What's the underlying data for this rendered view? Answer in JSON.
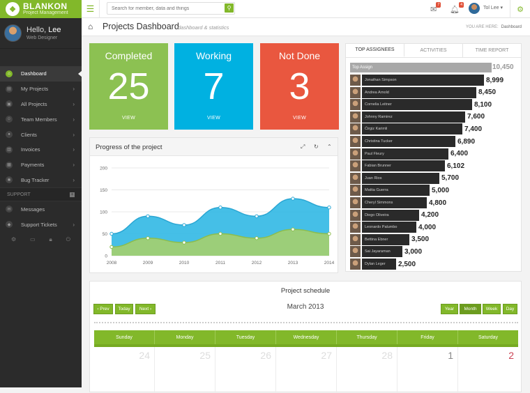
{
  "app": {
    "title": "BLANKON",
    "subtitle": "Project Management"
  },
  "profile": {
    "greeting": "Hello,",
    "name": "Lee",
    "role": "Web Designer"
  },
  "sidebar": {
    "items": [
      {
        "label": "Dashboard",
        "icon": "home-icon",
        "active": true
      },
      {
        "label": "My Projects",
        "icon": "folder-icon"
      },
      {
        "label": "All Projects",
        "icon": "briefcase-icon"
      },
      {
        "label": "Team Members",
        "icon": "users-icon"
      },
      {
        "label": "Clients",
        "icon": "user-icon"
      },
      {
        "label": "Invoices",
        "icon": "document-icon"
      },
      {
        "label": "Payments",
        "icon": "money-icon"
      },
      {
        "label": "Bug Tracker",
        "icon": "bug-icon"
      }
    ],
    "support_label": "SUPPORT",
    "support_items": [
      {
        "label": "Messages",
        "icon": "comments-icon"
      },
      {
        "label": "Support Tickets",
        "icon": "ticket-icon"
      }
    ]
  },
  "topbar": {
    "search_placeholder": "Search for member, data and things",
    "mail_badge": "7",
    "bell_badge": "4",
    "user_name": "Tol Lee"
  },
  "header": {
    "title": "Projects Dashboard",
    "subtitle": "dashboard & statistics",
    "crumb_label": "YOU ARE HERE:",
    "crumb_current": "Dashboard"
  },
  "stats": [
    {
      "title": "Completed",
      "value": "25",
      "link": "VIEW",
      "color": "#8cc152"
    },
    {
      "title": "Working",
      "value": "7",
      "link": "VIEW",
      "color": "#00b1e1"
    },
    {
      "title": "Not Done",
      "value": "3",
      "link": "VIEW",
      "color": "#e9573f"
    }
  ],
  "progress_panel": {
    "title": "Progress of the project"
  },
  "chart_data": {
    "type": "area",
    "title": "Progress of the project",
    "x": [
      "2008",
      "2009",
      "2010",
      "2011",
      "2012",
      "2013",
      "2014"
    ],
    "yticks": [
      "0",
      "50",
      "100",
      "150",
      "200"
    ],
    "ylim": [
      0,
      200
    ],
    "series": [
      {
        "values": [
          50,
          90,
          70,
          110,
          90,
          130,
          110
        ],
        "color": "#3bbce6"
      },
      {
        "values": [
          20,
          40,
          30,
          50,
          40,
          60,
          50
        ],
        "color": "#a5cf6d"
      }
    ],
    "grid": true
  },
  "assignees_panel": {
    "tabs": [
      "TOP ASSIGNEES",
      "ACTIVITIES",
      "TIME REPORT"
    ],
    "top_label": "Top Assign",
    "top_value": "10,450",
    "rows": [
      {
        "name": "Jonathan Simpson",
        "value": "8,999",
        "num": 8999
      },
      {
        "name": "Andrea Arnold",
        "value": "8,450",
        "num": 8450
      },
      {
        "name": "Cornelia Leitner",
        "value": "8,100",
        "num": 8100
      },
      {
        "name": "Johnny Ramirez",
        "value": "7,600",
        "num": 7600
      },
      {
        "name": "Ćirgiz Karimli",
        "value": "7,400",
        "num": 7400
      },
      {
        "name": "Christina Tucker",
        "value": "6,890",
        "num": 6890
      },
      {
        "name": "Paul Fleury",
        "value": "6,400",
        "num": 6400
      },
      {
        "name": "Fabian Brunner",
        "value": "6,102",
        "num": 6102
      },
      {
        "name": "Juan Rios",
        "value": "5,700",
        "num": 5700
      },
      {
        "name": "Mattia Guerra",
        "value": "5,000",
        "num": 5000
      },
      {
        "name": "Cheryl Simmons",
        "value": "4,800",
        "num": 4800
      },
      {
        "name": "Diego Oliveira",
        "value": "4,200",
        "num": 4200
      },
      {
        "name": "Leonardo Palumbo",
        "value": "4,000",
        "num": 4000
      },
      {
        "name": "Bettina Ebner",
        "value": "3,500",
        "num": 3500
      },
      {
        "name": "Sai Jayaraman",
        "value": "3,000",
        "num": 3000
      },
      {
        "name": "Dylan Leger",
        "value": "2,500",
        "num": 2500
      }
    ]
  },
  "schedule": {
    "title": "Project schedule",
    "month": "March 2013",
    "nav": [
      "‹ Prev",
      "Today",
      "Next ›"
    ],
    "views": [
      "Year",
      "Month",
      "Week",
      "Day"
    ],
    "days": [
      "Sunday",
      "Monday",
      "Tuesday",
      "Wednesday",
      "Thursday",
      "Friday",
      "Saturday"
    ],
    "dates": [
      "24",
      "25",
      "26",
      "27",
      "28",
      "1",
      "2"
    ]
  }
}
